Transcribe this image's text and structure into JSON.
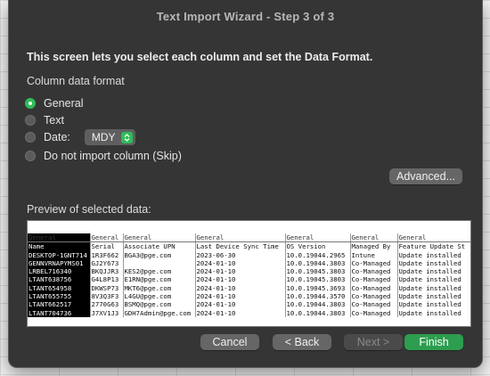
{
  "dialog": {
    "title": "Text Import Wizard - Step 3 of 3",
    "description": "This screen lets you select each column and set the Data Format."
  },
  "format": {
    "section_label": "Column data format",
    "options": [
      "General",
      "Text",
      "Date:",
      "Do not import column (Skip)"
    ],
    "selected": "General",
    "date_order": "MDY"
  },
  "buttons": {
    "advanced": "Advanced...",
    "cancel": "Cancel",
    "back": "< Back",
    "next": "Next >",
    "finish": "Finish"
  },
  "colors": {
    "accent": "#2ebd59",
    "dialog_bg": "#353535",
    "finish_bg": "#2d9d4f"
  },
  "preview": {
    "label": "Preview of selected data:",
    "column_types": [
      "General",
      "General",
      "General",
      "General",
      "General",
      "General",
      "General"
    ],
    "rows": [
      [
        "Name",
        "Serial",
        "Associate UPN",
        "Last Device Sync Time",
        "OS Version",
        "Managed By",
        "Feature Update St"
      ],
      [
        "DESKTOP-1GNT714",
        "1R3F662",
        "BGA3@pge.com",
        "2023-06-30",
        "10.0.19044.2965",
        "Intune",
        "Update installed"
      ],
      [
        "GENNVRNAPYMS01",
        "GJ2Y673",
        "",
        "2024-01-10",
        "10.0.19044.3803",
        "Co-Managed",
        "Update installed"
      ],
      [
        "LRBEL716340",
        "BKQJJR3",
        "KES2@pge.com",
        "2024-01-10",
        "10.0.19045.3803",
        "Co-Managed",
        "Update installed"
      ],
      [
        "LTANT638756",
        "G4L8P13",
        "E1RN@pge.com",
        "2024-01-10",
        "10.0.19045.3803",
        "Co-Managed",
        "Update installed"
      ],
      [
        "LTANT654958",
        "DKWSP73",
        "MKT6@pge.com",
        "2024-01-10",
        "10.0.19045.3693",
        "Co-Managed",
        "Update installed"
      ],
      [
        "LTANT655755",
        "8V3Q3F3",
        "L4GU@pge.com",
        "2024-01-10",
        "10.0.19044.3570",
        "Co-Managed",
        "Update installed"
      ],
      [
        "LTANT662517",
        "2770G63",
        "BSMQ@pge.com",
        "2024-01-10",
        "10.0.19044.3803",
        "Co-Managed",
        "Update installed"
      ],
      [
        "LTANT704736",
        "J7XV1J3",
        "GDH7Admin@pge.com",
        "2024-01-10",
        "10.0.19044.3803",
        "Co-Managed",
        "Update installed"
      ]
    ]
  }
}
